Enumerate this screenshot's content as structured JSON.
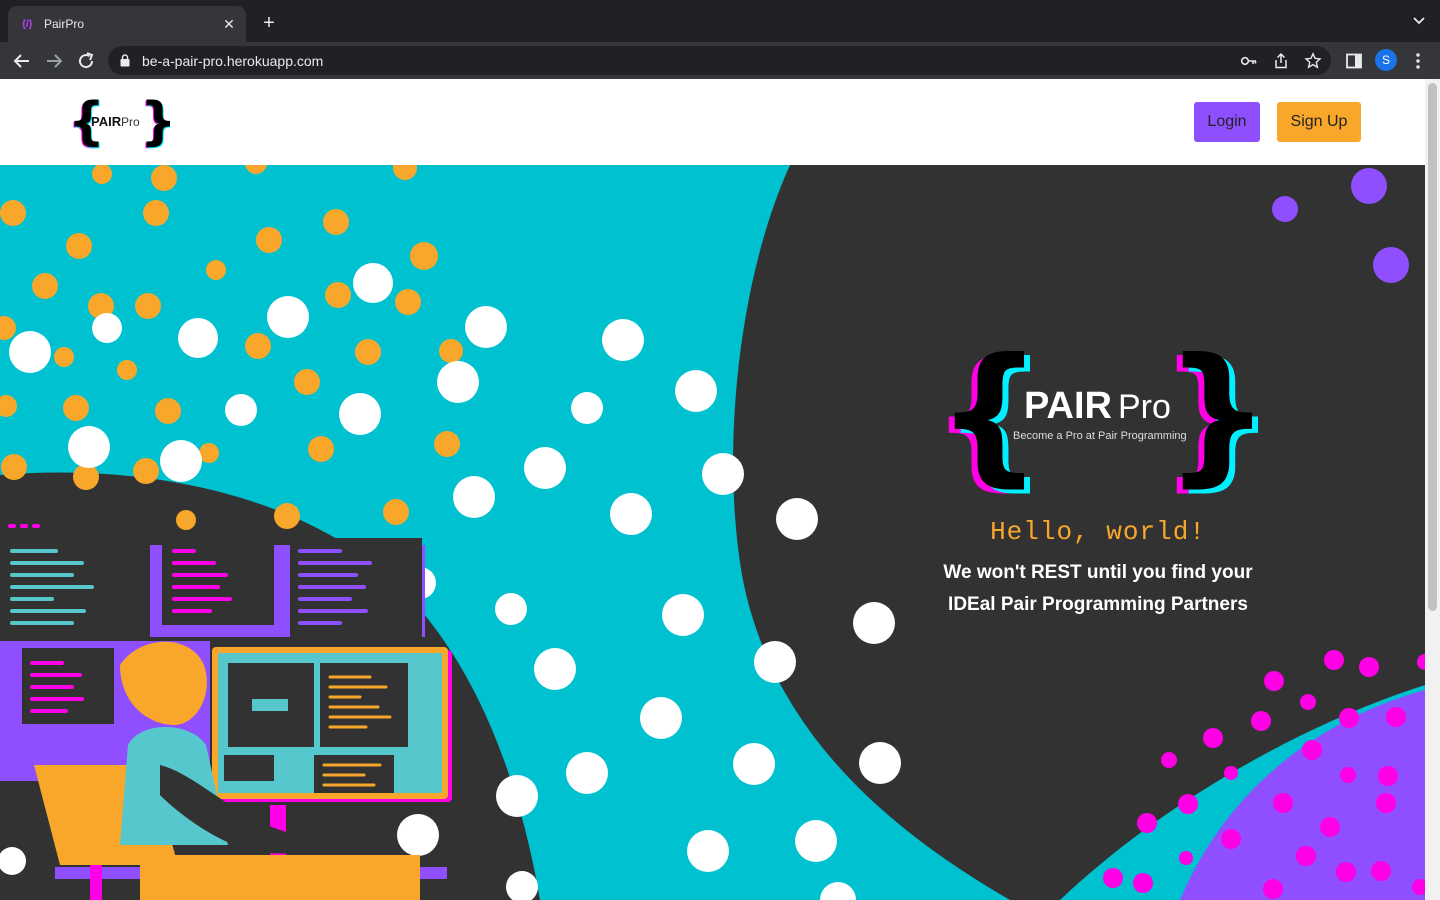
{
  "browser": {
    "tab_title": "PairPro",
    "url": "be-a-pair-pro.herokuapp.com",
    "avatar_letter": "S"
  },
  "navbar": {
    "logo_main": "PAIR",
    "logo_sub": "Pro",
    "login_label": "Login",
    "signup_label": "Sign Up"
  },
  "hero": {
    "logo_main": "PAIR",
    "logo_sub": "Pro",
    "logo_tagline": "Become a Pro at Pair Programming",
    "hello": "Hello, world!",
    "tagline_line1": "We won't REST until you find your",
    "tagline_line2": "IDEal Pair Programming Partners"
  },
  "colors": {
    "teal": "#00c1cf",
    "dark": "#333233",
    "orange": "#f9a72a",
    "purple": "#8f4fff",
    "magenta": "#ff00e6"
  }
}
